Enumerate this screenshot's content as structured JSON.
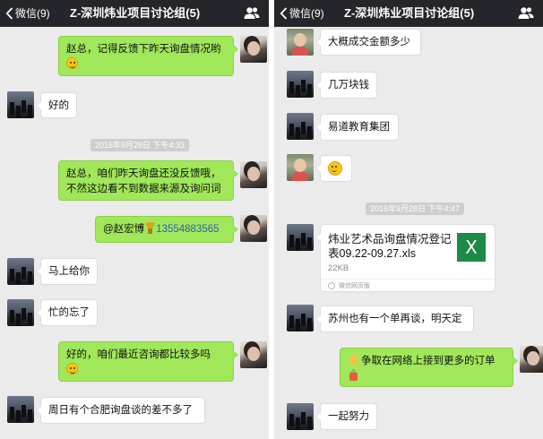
{
  "left": {
    "nav": {
      "back_label": "微信(9)",
      "title": "Z-深圳炜业项目讨论组(5)"
    },
    "messages": [
      {
        "text": "赵总，记得反馈下昨天询盘情况哟"
      },
      {
        "text": "好的"
      },
      {
        "timestamp": "2016年9月28日 下午4:33"
      },
      {
        "text": "赵总，咱们昨天询盘还没反馈哦，不然这边看不到数据来源及询问词"
      },
      {
        "mention": "@赵宏博",
        "phone": "13554883565"
      },
      {
        "text": "马上给你"
      },
      {
        "text": "忙的忘了"
      },
      {
        "text": "好的，咱们最近咨询都比较多吗"
      },
      {
        "text": "周日有个合肥询盘谈的差不多了"
      }
    ]
  },
  "right": {
    "nav": {
      "back_label": "微信(9)",
      "title": "Z-深圳炜业项目讨论组(5)"
    },
    "messages": [
      {
        "text": "大概成交金额多少"
      },
      {
        "text": "几万块钱"
      },
      {
        "text": "易道教育集团"
      },
      {
        "timestamp": "2016年9月28日 下午4:47"
      },
      {
        "file": {
          "name": "炜业艺术品询盘情况登记表09.22-09.27.xls",
          "size": "22KB",
          "icon_letter": "X",
          "source": "微信网页版"
        }
      },
      {
        "text": "苏州也有一个单再谈，明天定"
      },
      {
        "text": "争取在网络上接到更多的订单"
      },
      {
        "text": "一起努力"
      }
    ]
  },
  "colors": {
    "nav_bg": "#25262b",
    "chat_bg": "#ebebeb",
    "bubble_out": "#a0e75a",
    "bubble_in": "#ffffff",
    "excel_green": "#1d8a45",
    "phone_link": "#2c5fb3"
  },
  "icons": [
    "chevron-left-icon",
    "group-members-icon",
    "smile-emoji-icon",
    "trophy-emoji-icon",
    "thumbs-up-emoji-icon",
    "bottle-emoji-icon",
    "excel-file-icon"
  ]
}
